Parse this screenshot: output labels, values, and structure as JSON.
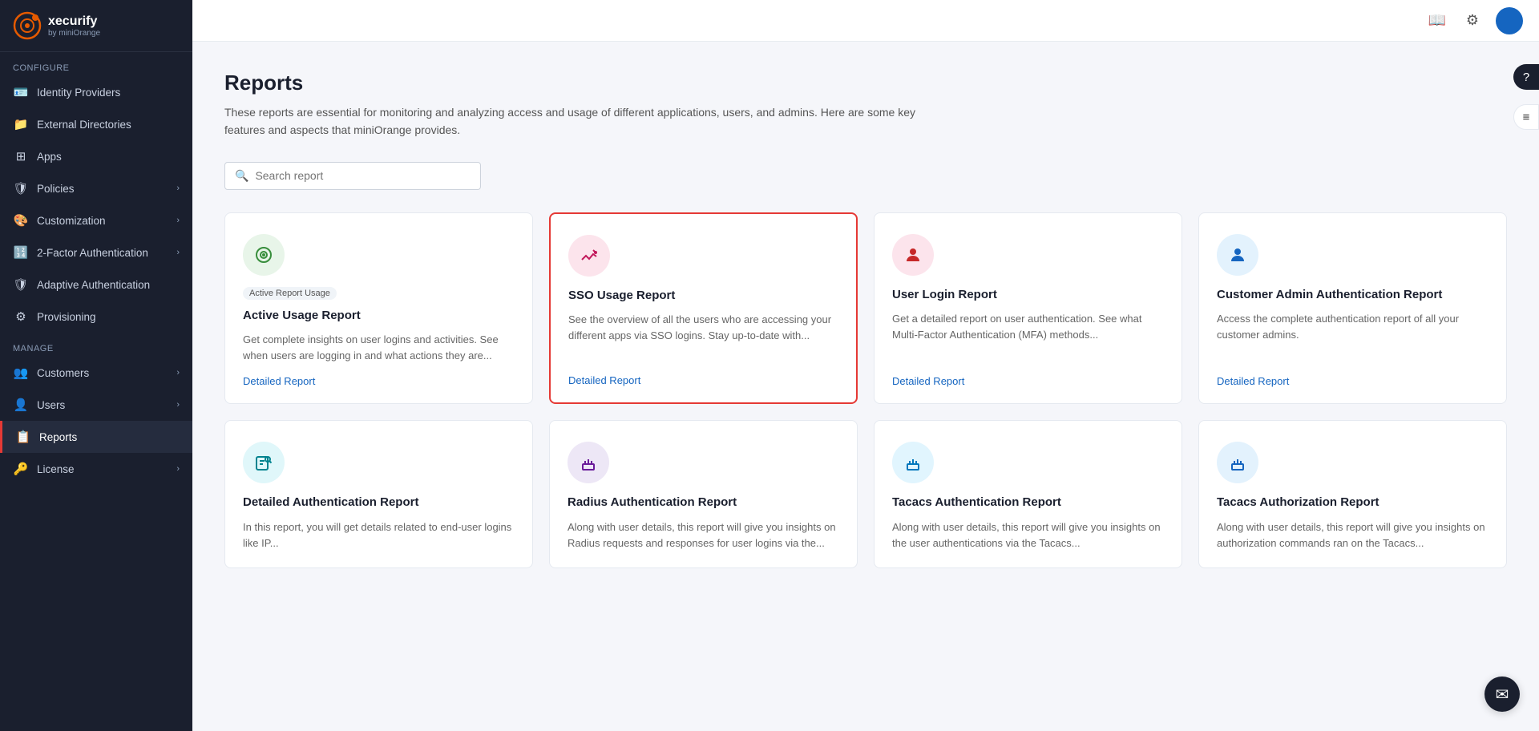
{
  "brand": {
    "name": "xecurify",
    "subtitle": "by miniOrange"
  },
  "sidebar": {
    "configure_label": "Configure",
    "manage_label": "Manage",
    "items_configure": [
      {
        "id": "identity-providers",
        "label": "Identity Providers",
        "icon": "🪪",
        "hasChevron": false
      },
      {
        "id": "external-directories",
        "label": "External Directories",
        "icon": "📁",
        "hasChevron": false
      },
      {
        "id": "apps",
        "label": "Apps",
        "icon": "⊞",
        "hasChevron": false
      },
      {
        "id": "policies",
        "label": "Policies",
        "icon": "🛡",
        "hasChevron": true
      },
      {
        "id": "customization",
        "label": "Customization",
        "icon": "🎨",
        "hasChevron": true
      },
      {
        "id": "2fa",
        "label": "2-Factor Authentication",
        "icon": "🔢",
        "hasChevron": true
      },
      {
        "id": "adaptive-auth",
        "label": "Adaptive Authentication",
        "icon": "🛡",
        "hasChevron": false
      },
      {
        "id": "provisioning",
        "label": "Provisioning",
        "icon": "⚙",
        "hasChevron": false
      }
    ],
    "items_manage": [
      {
        "id": "customers",
        "label": "Customers",
        "icon": "👥",
        "hasChevron": true
      },
      {
        "id": "users",
        "label": "Users",
        "icon": "👤",
        "hasChevron": true
      },
      {
        "id": "reports",
        "label": "Reports",
        "icon": "📋",
        "hasChevron": false,
        "active": true
      },
      {
        "id": "license",
        "label": "License",
        "icon": "🔑",
        "hasChevron": true
      }
    ]
  },
  "page": {
    "title": "Reports",
    "description": "These reports are essential for monitoring and analyzing access and usage of different applications, users, and admins. Here are some key features and aspects that miniOrange provides."
  },
  "search": {
    "placeholder": "Search report"
  },
  "cards": [
    {
      "id": "active-usage",
      "title": "Active Usage Report",
      "description": "Get complete insights on user logins and activities. See when users are logging in and what actions they are...",
      "link": "Detailed Report",
      "iconColor": "icon-green",
      "iconSymbol": "◎",
      "highlighted": false,
      "badge": "Active Report Usage"
    },
    {
      "id": "sso-usage",
      "title": "SSO Usage Report",
      "description": "See the overview of all the users who are accessing your different apps via SSO logins. Stay up-to-date with...",
      "link": "Detailed Report",
      "iconColor": "icon-pink",
      "iconSymbol": "📈",
      "highlighted": true,
      "badge": null
    },
    {
      "id": "user-login",
      "title": "User Login Report",
      "description": "Get a detailed report on user authentication. See what Multi-Factor Authentication (MFA) methods...",
      "link": "Detailed Report",
      "iconColor": "icon-peach",
      "iconSymbol": "👤",
      "highlighted": false,
      "badge": null
    },
    {
      "id": "customer-admin",
      "title": "Customer Admin Authentication Report",
      "description": "Access the complete authentication report of all your customer admins.",
      "link": "Detailed Report",
      "iconColor": "icon-blue",
      "iconSymbol": "👤",
      "highlighted": false,
      "badge": null
    },
    {
      "id": "detailed-auth",
      "title": "Detailed Authentication Report",
      "description": "In this report, you will get details related to end-user logins like IP...",
      "link": null,
      "iconColor": "icon-teal",
      "iconSymbol": "🔍",
      "highlighted": false,
      "badge": null
    },
    {
      "id": "radius-auth",
      "title": "Radius Authentication Report",
      "description": "Along with user details, this report will give you insights on Radius requests and responses for user logins via the...",
      "link": null,
      "iconColor": "icon-purple",
      "iconSymbol": "📡",
      "highlighted": false,
      "badge": null
    },
    {
      "id": "tacacs-auth",
      "title": "Tacacs Authentication Report",
      "description": "Along with user details, this report will give you insights on the user authentications via the Tacacs...",
      "link": null,
      "iconColor": "icon-lightblue",
      "iconSymbol": "📡",
      "highlighted": false,
      "badge": null
    },
    {
      "id": "tacacs-authz",
      "title": "Tacacs Authorization Report",
      "description": "Along with user details, this report will give you insights on authorization commands ran on the Tacacs...",
      "link": null,
      "iconColor": "icon-blue",
      "iconSymbol": "📡",
      "highlighted": false,
      "badge": null
    }
  ],
  "topbar": {
    "book_icon": "📖",
    "gear_icon": "⚙",
    "help_icon": "?",
    "menu_icon": "≡",
    "chat_icon": "✉"
  }
}
